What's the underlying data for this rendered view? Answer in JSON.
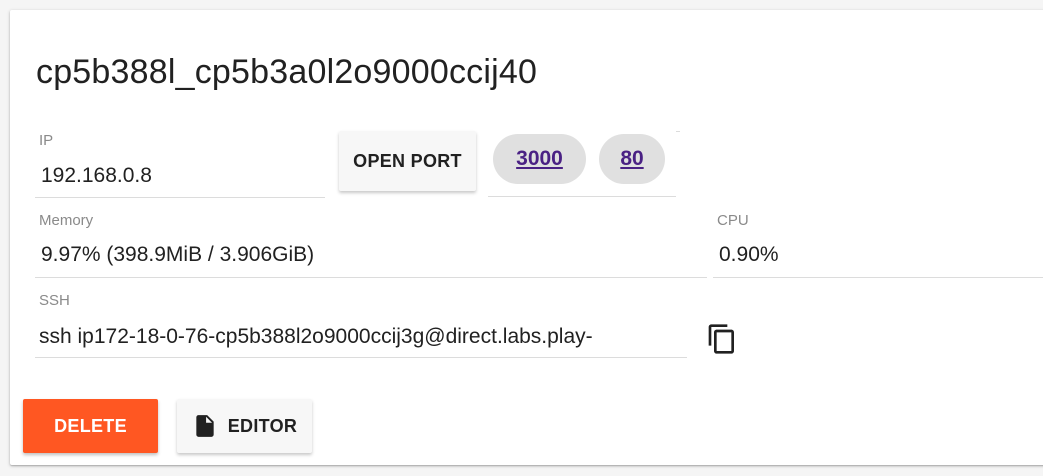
{
  "instance": {
    "title": "cp5b388l_cp5b3a0l2o9000ccij40"
  },
  "ip": {
    "label": "IP",
    "value": "192.168.0.8"
  },
  "ports": {
    "open_port_label": "OPEN PORT",
    "items": [
      "3000",
      "80"
    ]
  },
  "memory": {
    "label": "Memory",
    "value": "9.97% (398.9MiB / 3.906GiB)"
  },
  "cpu": {
    "label": "CPU",
    "value": "0.90%"
  },
  "ssh": {
    "label": "SSH",
    "value": "ssh ip172-18-0-76-cp5b388l2o9000ccij3g@direct.labs.play-",
    "copy_icon": "copy-icon"
  },
  "actions": {
    "delete_label": "DELETE",
    "editor_label": "EDITOR",
    "editor_icon": "file-icon"
  },
  "colors": {
    "delete": "#ff5722",
    "link": "#4a2184"
  }
}
